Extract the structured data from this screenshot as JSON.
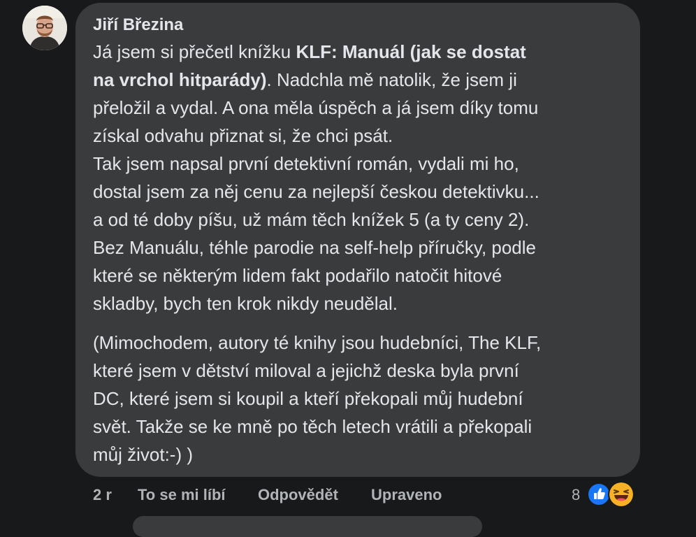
{
  "comment": {
    "author": "Jiří Březina",
    "paragraph1": [
      {
        "segments": [
          {
            "text": "Já jsem si přečetl knížku ",
            "bold": false
          },
          {
            "text": "KLF: Manuál (jak se dostat",
            "bold": true
          }
        ]
      },
      {
        "segments": [
          {
            "text": "na vrchol hitparády)",
            "bold": true
          },
          {
            "text": ". Nadchla mě natolik, že jsem ji",
            "bold": false
          }
        ]
      },
      {
        "segments": [
          {
            "text": "přeložil a vydal. A ona měla úspěch a já jsem díky tomu",
            "bold": false
          }
        ]
      },
      {
        "segments": [
          {
            "text": "získal odvahu přiznat si, že chci psát.",
            "bold": false
          }
        ]
      },
      {
        "segments": [
          {
            "text": "Tak jsem napsal první detektivní román, vydali mi ho,",
            "bold": false
          }
        ]
      },
      {
        "segments": [
          {
            "text": "dostal jsem za něj cenu za nejlepší českou detektivku...",
            "bold": false
          }
        ]
      },
      {
        "segments": [
          {
            "text": "a od té doby píšu, už mám těch knížek 5 (a ty ceny 2).",
            "bold": false
          }
        ]
      },
      {
        "segments": [
          {
            "text": "Bez Manuálu, téhle parodie na self-help příručky, podle",
            "bold": false
          }
        ]
      },
      {
        "segments": [
          {
            "text": "které se některým lidem fakt podařilo natočit hitové",
            "bold": false
          }
        ]
      },
      {
        "segments": [
          {
            "text": "skladby, bych ten krok nikdy neudělal.",
            "bold": false
          }
        ]
      }
    ],
    "paragraph2": [
      "(Mimochodem, autory té knihy jsou hudebníci, The KLF,",
      "které jsem v dětství miloval a jejichž deska byla první",
      "DC, které jsem si koupil a kteří překopali můj hudební",
      "svět. Takže se ke mně po těch letech vrátili a překopali",
      "můj život:-) )"
    ],
    "actions": {
      "time": "2 r",
      "like_label": "To se mi líbí",
      "reply_label": "Odpovědět",
      "edited_label": "Upraveno"
    },
    "reactions": {
      "count": "8",
      "types": [
        "like-icon",
        "haha-icon"
      ],
      "like_color": "#1877f2",
      "haha_color": "#f7b125"
    }
  },
  "theme": {
    "background": "#18191a",
    "bubble": "#3a3b3c",
    "text": "#e4e6eb",
    "secondary_text": "#b0b3b8"
  }
}
